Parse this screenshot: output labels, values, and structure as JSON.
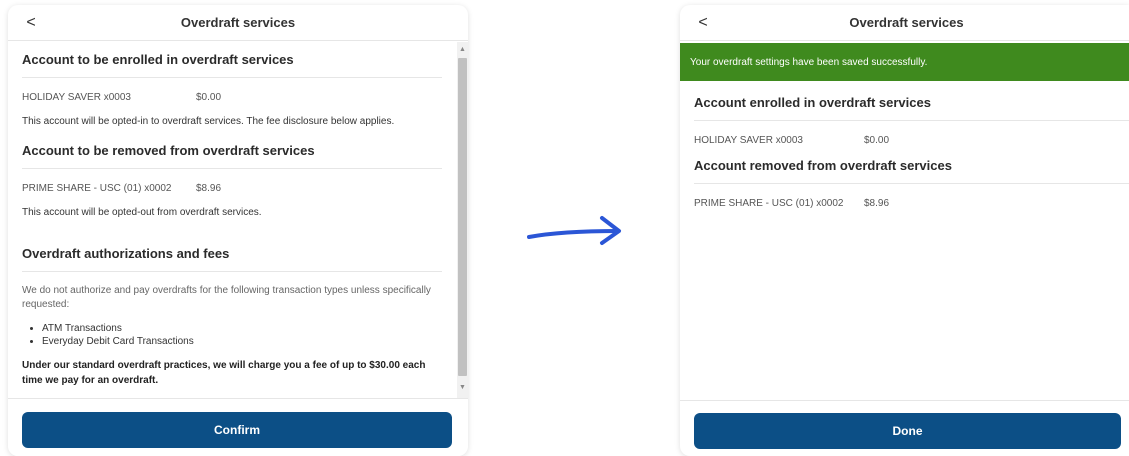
{
  "before": {
    "header": {
      "title": "Overdraft services",
      "back_glyph": "<"
    },
    "enroll_section": {
      "title": "Account to be enrolled in overdraft services",
      "account_name": "HOLIDAY SAVER x0003",
      "balance": "$0.00",
      "note": "This account will be opted-in to overdraft services. The fee disclosure below applies."
    },
    "remove_section": {
      "title": "Account to be removed from overdraft services",
      "account_name": "PRIME SHARE - USC (01) x0002",
      "balance": "$8.96",
      "note": "This account will be opted-out from overdraft services."
    },
    "fees_section": {
      "title": "Overdraft authorizations and fees",
      "intro": "We do not authorize and pay overdrafts for the following transaction types unless specifically requested:",
      "bullets": [
        "ATM Transactions",
        "Everyday Debit Card Transactions"
      ],
      "fee_text": "Under our standard overdraft practices, we will charge you a fee of up to $30.00 each time we pay for an overdraft."
    },
    "confirm_label": "Confirm"
  },
  "after": {
    "header": {
      "title": "Overdraft services",
      "back_glyph": "<"
    },
    "success_message": "Your overdraft settings have been saved successfully.",
    "enrolled_section": {
      "title": "Account enrolled in overdraft services",
      "account_name": "HOLIDAY SAVER x0003",
      "balance": "$0.00"
    },
    "removed_section": {
      "title": "Account removed from overdraft services",
      "account_name": "PRIME SHARE - USC (01) x0002",
      "balance": "$8.96"
    },
    "done_label": "Done"
  },
  "colors": {
    "primary_button": "#0c4f86",
    "success_banner": "#3f8a1e",
    "arrow": "#2b56d6"
  }
}
